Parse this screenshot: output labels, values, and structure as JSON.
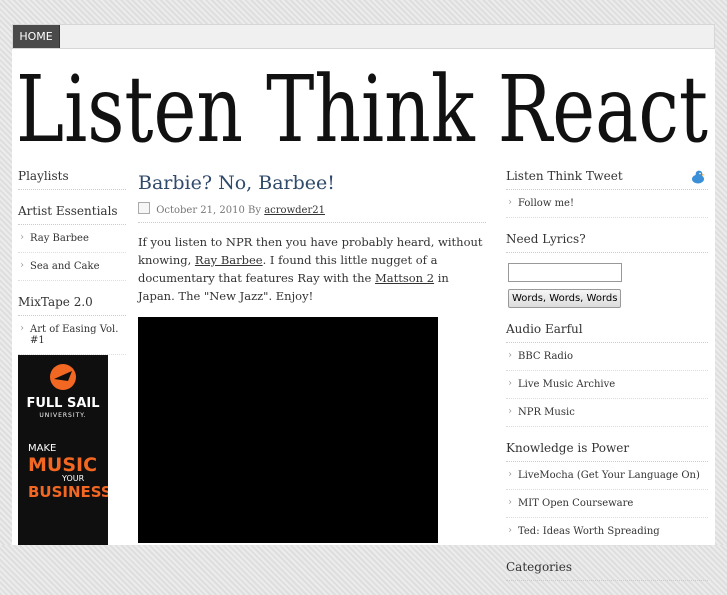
{
  "nav": {
    "home_label": "HOME"
  },
  "site": {
    "title": "Listen Think React"
  },
  "left": {
    "playlists_title": "Playlists",
    "artist_title": "Artist Essentials",
    "artist_items": [
      "Ray Barbee",
      "Sea and Cake"
    ],
    "mixtape_title": "MixTape 2.0",
    "mixtape_items": [
      "Art of Easing Vol. #1"
    ],
    "ad": {
      "line1": "FULL SAIL",
      "line2": "UNIVERSITY.",
      "line3": "MAKE",
      "line4": "MUSIC",
      "line5": "YOUR",
      "line6": "BUSINESS"
    }
  },
  "post": {
    "title": "Barbie? No, Barbee!",
    "date": "October 21, 2010",
    "by": "By",
    "author": "acrowder21",
    "text1": "If you listen to NPR then you have probably heard, without knowing, ",
    "link1": "Ray Barbee",
    "text2": ". I found this little nugget of a documentary that features Ray with the ",
    "link2": "Mattson 2",
    "text3": " in Japan. The \"New Jazz\". Enjoy!"
  },
  "right": {
    "tweet_title": "Listen Think Tweet",
    "tweet_items": [
      "Follow me!"
    ],
    "lyrics_title": "Need Lyrics?",
    "lyrics_button": "Words, Words, Words",
    "audio_title": "Audio Earful",
    "audio_items": [
      "BBC Radio",
      "Live Music Archive",
      "NPR Music"
    ],
    "knowledge_title": "Knowledge is Power",
    "knowledge_items": [
      "LiveMocha (Get Your Language On)",
      "MIT Open Courseware",
      "Ted: Ideas Worth Spreading"
    ],
    "categories_title": "Categories"
  },
  "colors": {
    "title_blue": "#2f4a6b",
    "ad_orange": "#f26722",
    "bird_blue": "#3b8fd6"
  }
}
